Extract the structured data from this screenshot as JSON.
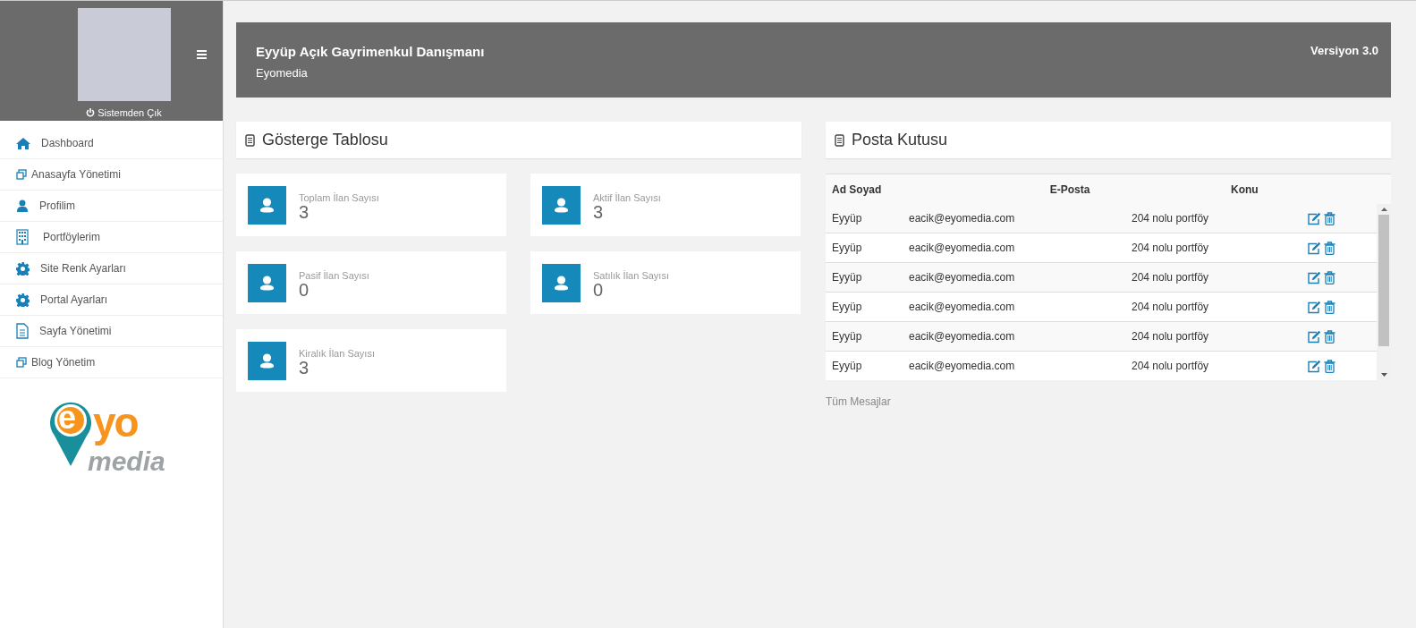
{
  "sidebar": {
    "logout": "Sistemden Çık",
    "items": [
      {
        "kind": "home",
        "label": "Dashboard"
      },
      {
        "kind": "window",
        "label": "Anasayfa Yönetimi"
      },
      {
        "kind": "user",
        "label": "Profilim"
      },
      {
        "kind": "building",
        "label": "Portföylerim"
      },
      {
        "kind": "gear",
        "label": "Site Renk Ayarları"
      },
      {
        "kind": "gear",
        "label": "Portal Ayarları"
      },
      {
        "kind": "file",
        "label": "Sayfa Yönetimi"
      },
      {
        "kind": "window",
        "label": "Blog Yönetim"
      }
    ],
    "logo": {
      "mark": "e",
      "word": "yo",
      "sub": "media"
    }
  },
  "header": {
    "title": "Eyyüp Açık Gayrimenkul Danışmanı",
    "subtitle": "Eyomedia",
    "version": "Versiyon 3.0"
  },
  "dashboard": {
    "title": "Gösterge Tablosu",
    "stats": [
      {
        "label": "Toplam İlan Sayısı",
        "value": "3"
      },
      {
        "label": "Aktif İlan Sayısı",
        "value": "3"
      },
      {
        "label": "Pasif İlan Sayısı",
        "value": "0"
      },
      {
        "label": "Satılık İlan Sayısı",
        "value": "0"
      },
      {
        "label": "Kiralık İlan Sayısı",
        "value": "3"
      }
    ]
  },
  "inbox": {
    "title": "Posta Kutusu",
    "columns": [
      "Ad Soyad",
      "E-Posta",
      "Konu"
    ],
    "rows": [
      {
        "name": "Eyyüp",
        "email": "eacik@eyomedia.com",
        "subject": "204 nolu portföy"
      },
      {
        "name": "Eyyüp",
        "email": "eacik@eyomedia.com",
        "subject": "204 nolu portföy"
      },
      {
        "name": "Eyyüp",
        "email": "eacik@eyomedia.com",
        "subject": "204 nolu portföy"
      },
      {
        "name": "Eyyüp",
        "email": "eacik@eyomedia.com",
        "subject": "204 nolu portföy"
      },
      {
        "name": "Eyyüp",
        "email": "eacik@eyomedia.com",
        "subject": "204 nolu portföy"
      },
      {
        "name": "Eyyüp",
        "email": "eacik@eyomedia.com",
        "subject": "204 nolu portföy"
      }
    ],
    "all_link": "Tüm Mesajlar"
  }
}
